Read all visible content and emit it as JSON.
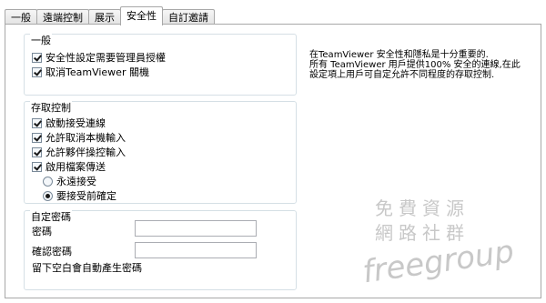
{
  "tabs": [
    "一般",
    "遠端控制",
    "展示",
    "安全性",
    "自訂邀請"
  ],
  "active_tab": "安全性",
  "general": {
    "title": "一般",
    "options": [
      {
        "label": "安全性設定需要管理員授權",
        "checked": true
      },
      {
        "label": "取消TeamViewer 關機",
        "checked": true
      }
    ]
  },
  "access": {
    "title": "存取控制",
    "options": [
      {
        "label": "啟動接受連線",
        "checked": true
      },
      {
        "label": "允許取消本機輸入",
        "checked": true
      },
      {
        "label": "允許夥伴操控輸入",
        "checked": true
      },
      {
        "label": "啟用檔案傳送",
        "checked": true
      }
    ],
    "radios": [
      {
        "label": "永遠接受",
        "selected": false
      },
      {
        "label": "要接受前確定",
        "selected": true
      }
    ]
  },
  "password": {
    "title": "自定密碼",
    "password_label": "密碼",
    "confirm_label": "確認密碼",
    "hint": "留下空白會自動產生密碼"
  },
  "info_lines": [
    "在TeamViewer 安全性和隱私是十分重要的.",
    "所有 TeamViewer 用戶提供100% 安全的連線,在此",
    "設定項上用戶可自定允許不同程度的存取控制."
  ],
  "watermark": {
    "line1": "免費資源",
    "line2": "網路社群",
    "line3": "freegroup"
  }
}
